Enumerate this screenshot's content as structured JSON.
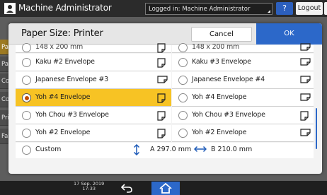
{
  "header": {
    "title": "Machine Administrator",
    "login_status": "Logged in: Machine Administrator",
    "help_label": "?",
    "logout_label": "Logout"
  },
  "background_tabs": [
    "Pap",
    "Pap",
    "Con",
    "Cop",
    "Prin",
    "Fax"
  ],
  "dialog": {
    "title": "Paper Size: Printer",
    "cancel_label": "Cancel",
    "ok_label": "OK"
  },
  "list": {
    "partial_row": {
      "left": {
        "label": "148 x 200 mm",
        "orientation": "portrait"
      },
      "right": {
        "label": "148 x 200 mm",
        "orientation": "landscape"
      }
    },
    "rows": [
      {
        "left": {
          "label": "Kaku #2 Envelope",
          "orientation": "portrait",
          "selected": false
        },
        "right": {
          "label": "Kaku #3 Envelope",
          "orientation": "landscape",
          "selected": false
        }
      },
      {
        "left": {
          "label": "Japanese Envelope #3",
          "orientation": "landscape",
          "selected": false
        },
        "right": {
          "label": "Japanese Envelope #4",
          "orientation": "landscape",
          "selected": false
        }
      },
      {
        "left": {
          "label": "Yoh #4 Envelope",
          "orientation": "portrait",
          "selected": true
        },
        "right": {
          "label": "Yoh #4 Envelope",
          "orientation": "landscape",
          "selected": false
        }
      },
      {
        "left": {
          "label": "Yoh Chou #3 Envelope",
          "orientation": "portrait",
          "selected": false
        },
        "right": {
          "label": "Yoh Chou #3 Envelope",
          "orientation": "portrait",
          "selected": false
        }
      },
      {
        "left": {
          "label": "Yoh #2 Envelope",
          "orientation": "portrait",
          "selected": false
        },
        "right": {
          "label": "Yoh #2 Envelope",
          "orientation": "landscape",
          "selected": false
        }
      }
    ],
    "custom": {
      "label": "Custom",
      "vertical": "A 297.0 mm",
      "horizontal": "B 210.0 mm"
    },
    "scroll_position": 0.72
  },
  "footer": {
    "date": "17 Sep. 2019",
    "time": "17:33"
  },
  "colors": {
    "accent": "#2c68c9",
    "selected_row": "#f7c324",
    "selected_dot": "#c24a00"
  }
}
